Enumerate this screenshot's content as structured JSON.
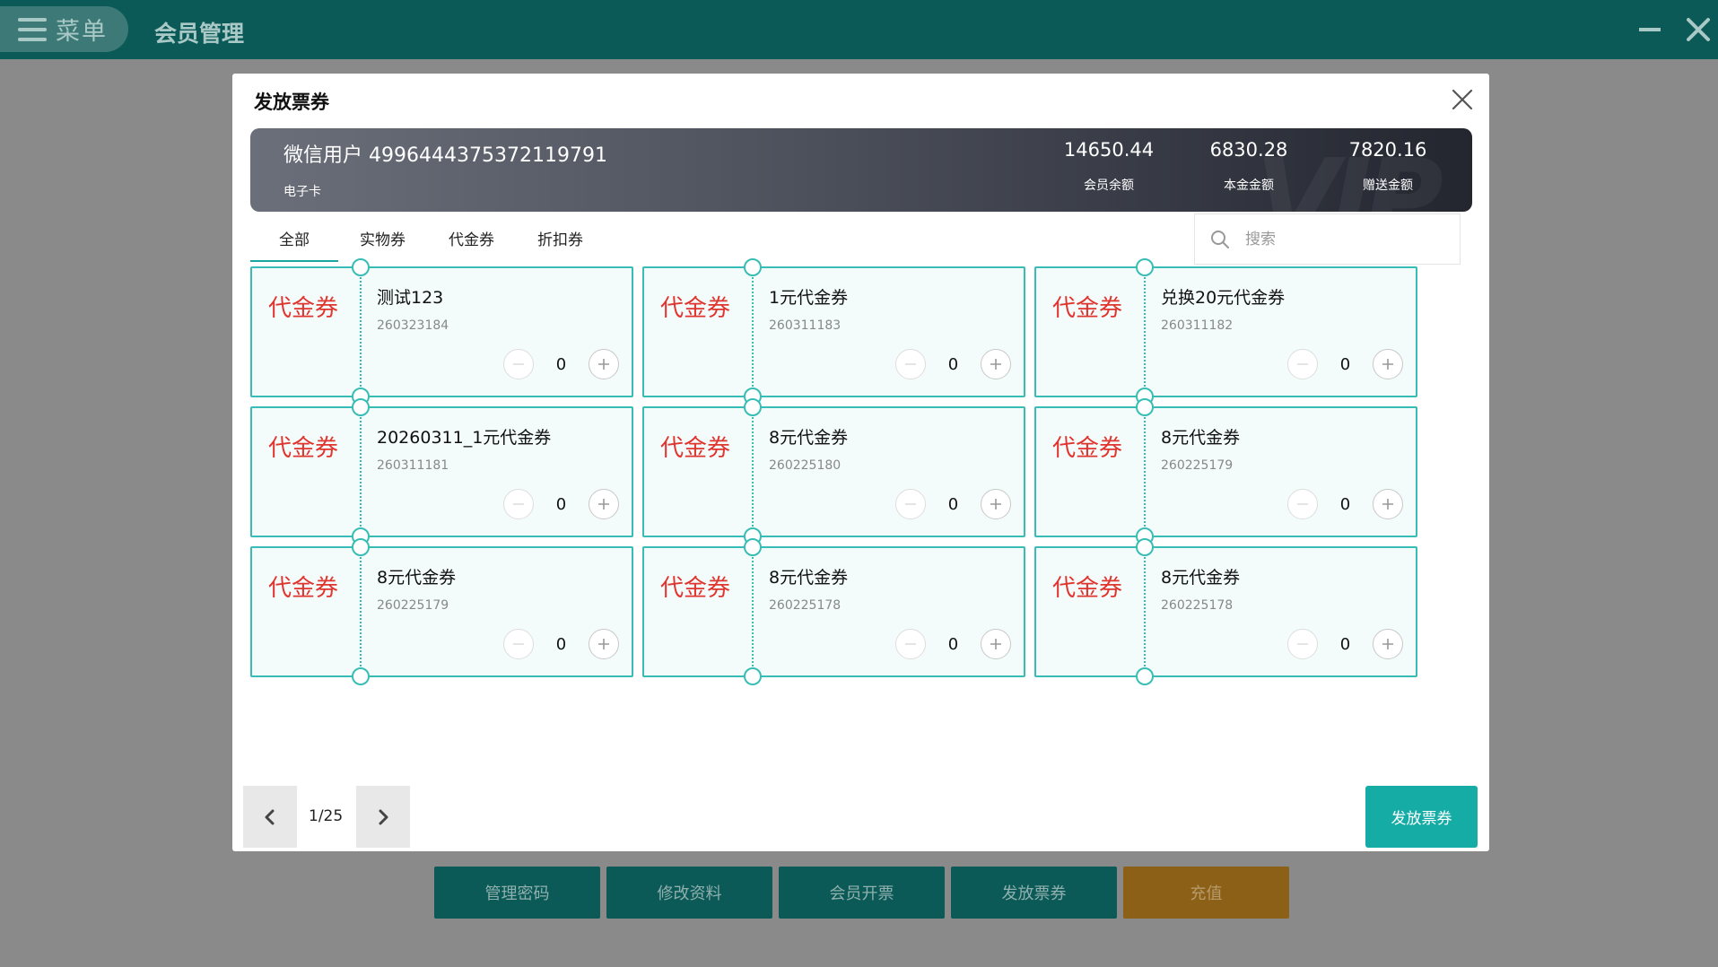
{
  "app": {
    "menu_label": "菜单",
    "title": "会员管理"
  },
  "bottom_actions": [
    {
      "label": "管理密码"
    },
    {
      "label": "修改资料"
    },
    {
      "label": "会员开票"
    },
    {
      "label": "发放票券"
    },
    {
      "label": "充值"
    }
  ],
  "modal": {
    "title": "发放票券",
    "member": {
      "name": "微信用户 4996444375372119791",
      "card_type": "电子卡",
      "balance": "14650.44",
      "balance_label": "会员余额",
      "principal": "6830.28",
      "principal_label": "本金金额",
      "bonus": "7820.16",
      "bonus_label": "赠送金额",
      "watermark": "VIP"
    },
    "tabs": [
      {
        "label": "全部",
        "active": true
      },
      {
        "label": "实物券",
        "active": false
      },
      {
        "label": "代金券",
        "active": false
      },
      {
        "label": "折扣券",
        "active": false
      }
    ],
    "search": {
      "placeholder": "搜索"
    },
    "coupons": [
      {
        "type": "代金券",
        "name": "测试123",
        "code": "260323184",
        "qty": "0"
      },
      {
        "type": "代金券",
        "name": "1元代金券",
        "code": "260311183",
        "qty": "0"
      },
      {
        "type": "代金券",
        "name": "兑换20元代金券",
        "code": "260311182",
        "qty": "0"
      },
      {
        "type": "代金券",
        "name": "20260311_1元代金券",
        "code": "260311181",
        "qty": "0"
      },
      {
        "type": "代金券",
        "name": "8元代金券",
        "code": "260225180",
        "qty": "0"
      },
      {
        "type": "代金券",
        "name": "8元代金券",
        "code": "260225179",
        "qty": "0"
      },
      {
        "type": "代金券",
        "name": "8元代金券",
        "code": "260225179",
        "qty": "0"
      },
      {
        "type": "代金券",
        "name": "8元代金券",
        "code": "260225178",
        "qty": "0"
      },
      {
        "type": "代金券",
        "name": "8元代金券",
        "code": "260225178",
        "qty": "0"
      }
    ],
    "pagination": {
      "text": "1/25"
    },
    "issue_button": "发放票券"
  },
  "colors": {
    "topbar": "#0c5a57",
    "accent": "#15aca5",
    "coupon_border": "#37bdb5",
    "coupon_type": "#e0342e",
    "recharge": "#8c6117"
  },
  "icons": [
    "menu-icon",
    "minimize-icon",
    "close-icon",
    "search-icon",
    "minus-icon",
    "plus-icon",
    "chevron-left-icon",
    "chevron-right-icon"
  ]
}
